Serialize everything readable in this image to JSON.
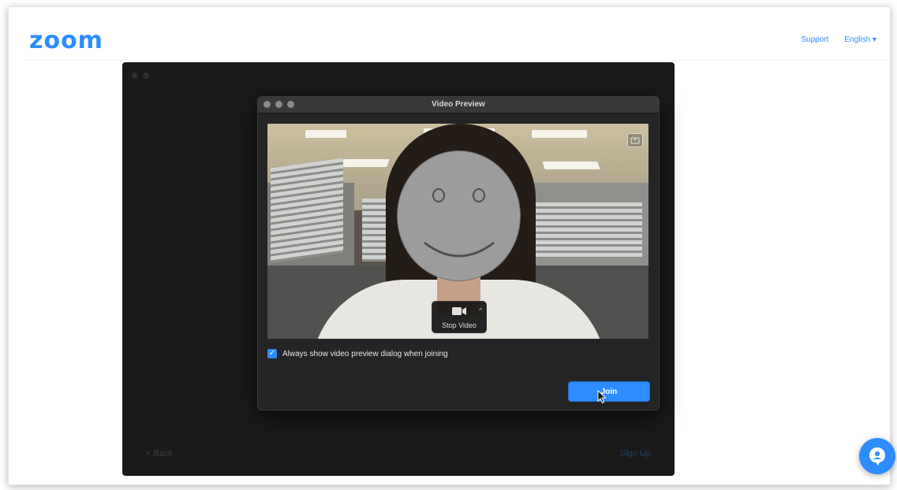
{
  "header": {
    "logo": "zoom",
    "support_label": "Support",
    "language_label": "English ▾"
  },
  "app_window": {
    "back_label": "< Back",
    "signup_label": "Sign Up"
  },
  "dialog": {
    "title": "Video Preview",
    "stop_video_label": "Stop Video",
    "checkbox_label": "Always show video preview dialog when joining",
    "checkbox_checked": true,
    "join_label": "Join"
  },
  "colors": {
    "brand": "#2D8CFF",
    "dialog_bg": "#242424",
    "app_bg": "#1a1a1a"
  },
  "icons": {
    "camera": "video-camera-icon",
    "switch_camera": "switch-camera-icon",
    "chat": "chat-help-icon",
    "check": "checkmark-icon"
  }
}
